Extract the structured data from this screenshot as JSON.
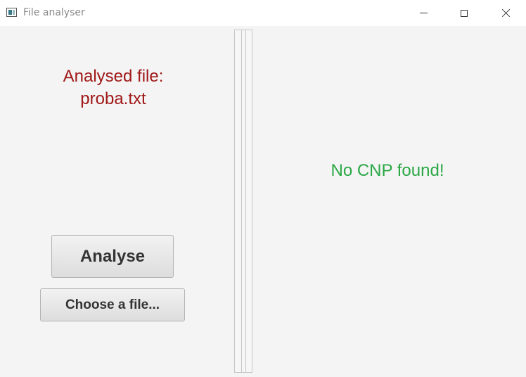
{
  "window": {
    "title": "File analyser",
    "icon": "app-window-icon"
  },
  "left_panel": {
    "analysed_label": "Analysed file:",
    "analysed_file": "proba.txt",
    "analyse_button": "Analyse",
    "choose_button": "Choose a file..."
  },
  "right_panel": {
    "result": "No CNP found!"
  },
  "colors": {
    "label_red": "#a01818",
    "result_green": "#2aa845",
    "background": "#f4f4f4"
  }
}
